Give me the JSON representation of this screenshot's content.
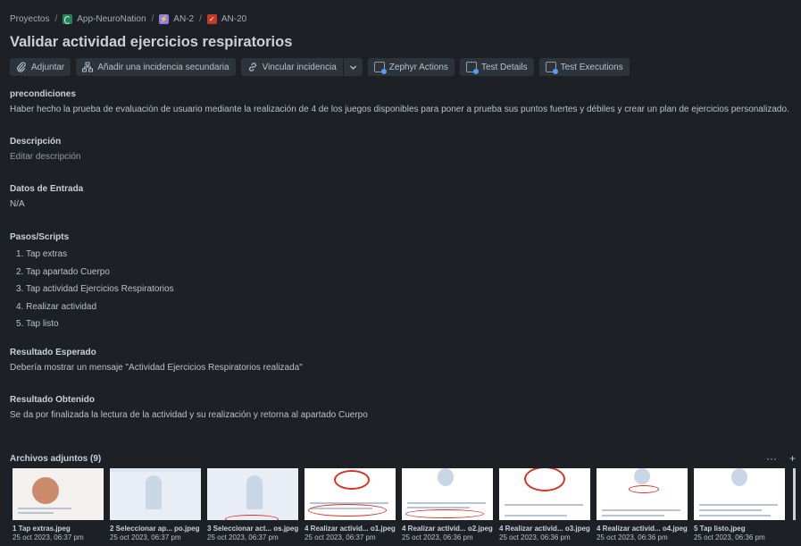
{
  "breadcrumb": {
    "projects": "Proyectos",
    "project": "App-NeuroNation",
    "epic": "AN-2",
    "issue": "AN-20"
  },
  "title": "Validar actividad ejercicios respiratorios",
  "toolbar": {
    "attach": "Adjuntar",
    "add_child": "Añadir una incidencia secundaria",
    "link": "Vincular incidencia",
    "zephyr_actions": "Zephyr Actions",
    "test_details": "Test Details",
    "test_executions": "Test Executions"
  },
  "sections": {
    "preconditions": {
      "label": "precondiciones",
      "text": "Haber hecho la prueba de evaluación de usuario mediante la realización de 4 de los juegos disponibles para poner a prueba sus puntos fuertes y débiles y crear un plan de ejercicios personalizado."
    },
    "description": {
      "label": "Descripción",
      "placeholder": "Editar descripción"
    },
    "input_data": {
      "label": "Datos de Entrada",
      "text": "N/A"
    },
    "steps": {
      "label": "Pasos/Scripts",
      "items": [
        "1. Tap extras",
        "2. Tap apartado Cuerpo",
        "3. Tap actividad Ejercicios Respiratorios",
        "4. Realizar actividad",
        "5. Tap listo"
      ]
    },
    "expected": {
      "label": "Resultado Esperado",
      "text": "Debería mostrar un mensaje \"Actividad Ejercicios Respiratorios realizada\""
    },
    "actual": {
      "label": "Resultado Obtenido",
      "text": "Se da por finalizada la lectura de la actividad y su realización y retorna al apartado Cuerpo"
    }
  },
  "attachments": {
    "title": "Archivos adjuntos (9)",
    "more": "···",
    "add": "+",
    "items": [
      {
        "name": "1 Tap extras.jpeg",
        "date": "25 oct 2023, 06:37 pm"
      },
      {
        "name": "2 Seleccionar ap... po.jpeg",
        "date": "25 oct 2023, 06:37 pm"
      },
      {
        "name": "3 Seleccionar act... os.jpeg",
        "date": "25 oct 2023, 06:37 pm"
      },
      {
        "name": "4 Realizar activid... o1.jpeg",
        "date": "25 oct 2023, 06:37 pm"
      },
      {
        "name": "4 Realizar activid... o2.jpeg",
        "date": "25 oct 2023, 06:36 pm"
      },
      {
        "name": "4 Realizar activid... o3.jpeg",
        "date": "25 oct 2023, 06:36 pm"
      },
      {
        "name": "4 Realizar activid... o4.jpeg",
        "date": "25 oct 2023, 06:36 pm"
      },
      {
        "name": "5 Tap listo.jpeg",
        "date": "25 oct 2023, 06:36 pm"
      }
    ]
  },
  "colors": {
    "background": "#1d2125",
    "button": "#2c333a",
    "text": "#b6c2cf",
    "project_icon": "#1f845a",
    "epic_icon": "#8f7ee7",
    "test_icon": "#c9372c"
  }
}
